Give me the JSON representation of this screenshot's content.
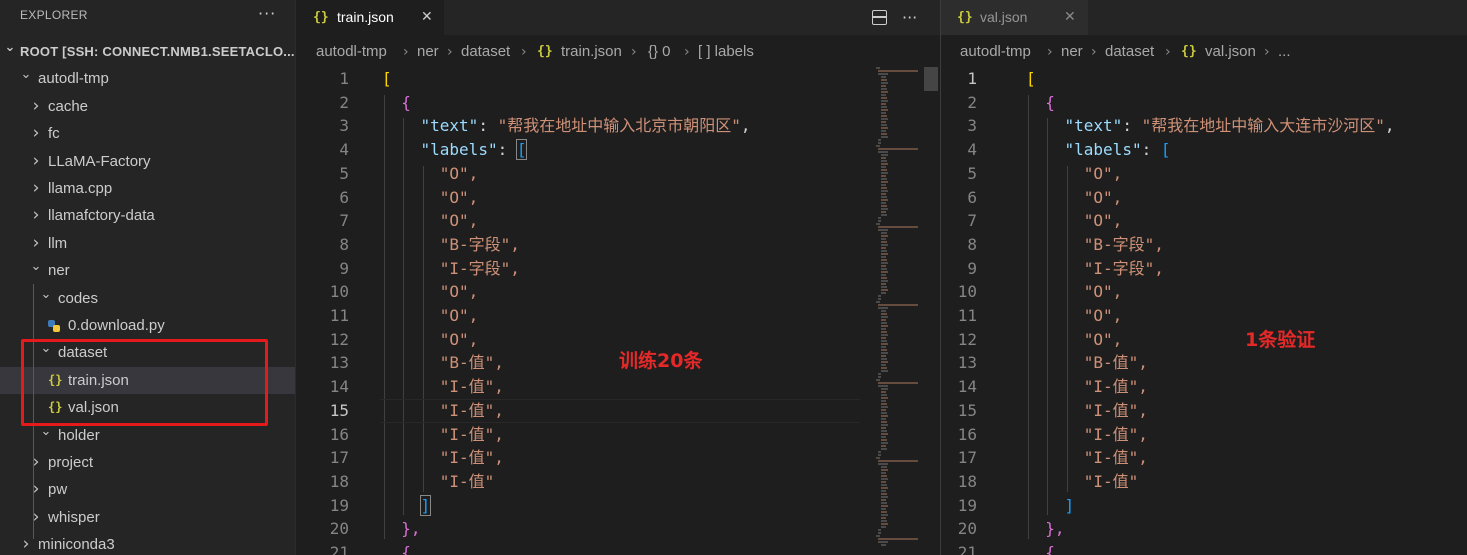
{
  "explorer": {
    "title": "EXPLORER",
    "more_label": "···",
    "root_label": "ROOT [SSH: CONNECT.NMB1.SEETACLO...",
    "items": [
      {
        "label": "autodl-tmp",
        "expanded": true,
        "type": "folder"
      },
      {
        "label": "cache",
        "expanded": false,
        "type": "folder"
      },
      {
        "label": "fc",
        "expanded": false,
        "type": "folder"
      },
      {
        "label": "LLaMA-Factory",
        "expanded": false,
        "type": "folder"
      },
      {
        "label": "llama.cpp",
        "expanded": false,
        "type": "folder"
      },
      {
        "label": "llamafctory-data",
        "expanded": false,
        "type": "folder"
      },
      {
        "label": "llm",
        "expanded": false,
        "type": "folder"
      },
      {
        "label": "ner",
        "expanded": true,
        "type": "folder"
      },
      {
        "label": "codes",
        "expanded": true,
        "type": "folder"
      },
      {
        "label": "0.download.py",
        "type": "python-file"
      },
      {
        "label": "dataset",
        "expanded": true,
        "type": "folder"
      },
      {
        "label": "train.json",
        "type": "json-file",
        "selected": true
      },
      {
        "label": "val.json",
        "type": "json-file"
      },
      {
        "label": "holder",
        "expanded": true,
        "type": "folder"
      },
      {
        "label": "project",
        "expanded": false,
        "type": "folder"
      },
      {
        "label": "pw",
        "expanded": false,
        "type": "folder"
      },
      {
        "label": "whisper",
        "expanded": false,
        "type": "folder"
      },
      {
        "label": "miniconda3",
        "expanded": false,
        "type": "folder"
      }
    ],
    "json_icon": "{}"
  },
  "left_editor": {
    "tab_label": "train.json",
    "tab_icon": "{}",
    "close_glyph": "✕",
    "more_glyph": "···",
    "breadcrumb": [
      "autodl-tmp",
      "ner",
      "dataset",
      "train.json",
      "{} 0",
      "[ ] labels"
    ],
    "annotation": "训练20条",
    "current_line": 15
  },
  "right_editor": {
    "tab_label": "val.json",
    "tab_icon": "{}",
    "close_glyph": "✕",
    "breadcrumb": [
      "autodl-tmp",
      "ner",
      "dataset",
      "val.json",
      "..."
    ],
    "annotation": "1条验证",
    "current_line": 1
  },
  "left_code": {
    "line_numbers": [
      "1",
      "2",
      "3",
      "4",
      "5",
      "6",
      "7",
      "8",
      "9",
      "10",
      "11",
      "12",
      "13",
      "14",
      "15",
      "16",
      "17",
      "18",
      "19",
      "20",
      "21"
    ],
    "text_value": "\"帮我在地址中输入北京市朝阳区\"",
    "labels": [
      "\"O\",",
      "\"O\",",
      "\"O\",",
      "\"B-字段\",",
      "\"I-字段\",",
      "\"O\",",
      "\"O\",",
      "\"O\",",
      "\"B-值\",",
      "\"I-值\",",
      "\"I-值\",",
      "\"I-值\",",
      "\"I-值\",",
      "\"I-值\""
    ]
  },
  "right_code": {
    "line_numbers": [
      "1",
      "2",
      "3",
      "4",
      "5",
      "6",
      "7",
      "8",
      "9",
      "10",
      "11",
      "12",
      "13",
      "14",
      "15",
      "16",
      "17",
      "18",
      "19",
      "20",
      "21"
    ],
    "text_value": "\"帮我在地址中输入大连市沙河区\"",
    "labels": [
      "\"O\",",
      "\"O\",",
      "\"O\",",
      "\"B-字段\",",
      "\"I-字段\",",
      "\"O\",",
      "\"O\",",
      "\"O\",",
      "\"B-值\",",
      "\"I-值\",",
      "\"I-值\",",
      "\"I-值\",",
      "\"I-值\",",
      "\"I-值\""
    ]
  },
  "code_tokens": {
    "open_array": "[",
    "open_object": "{",
    "key_text": "\"text\"",
    "key_labels": "\"labels\"",
    "colon": ": ",
    "comma": ",",
    "close_array": "]",
    "close_object_comma": "},",
    "close_object": "}",
    "next_open_object": "{",
    "final_close_array": "]"
  },
  "colors": {
    "editor_bg": "#1e1e1e",
    "sidebar_bg": "#252526",
    "string": "#ce9178",
    "key": "#9cdcfe",
    "bracket_level1": "#ffd700",
    "bracket_level2": "#da70d6",
    "bracket_level3": "#179fff",
    "annotation": "#e52929",
    "highlight_box": "#e51a1a"
  }
}
